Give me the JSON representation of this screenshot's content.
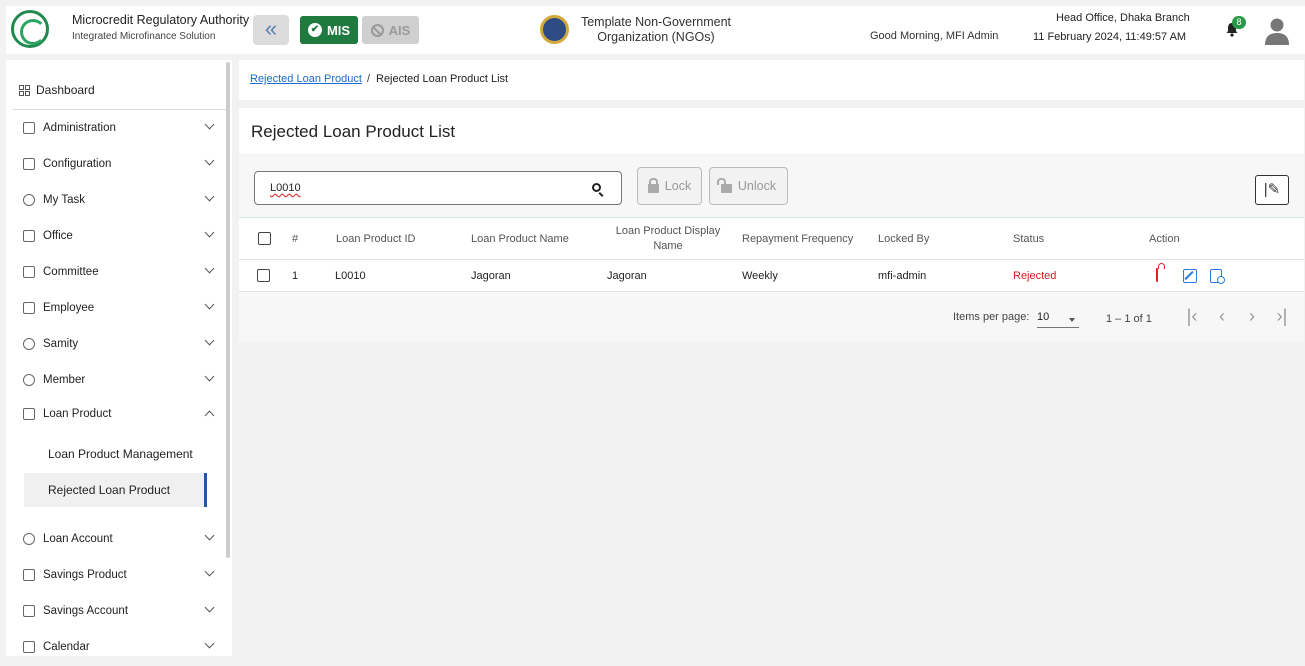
{
  "header": {
    "brand_title": "Microcredit Regulatory Authority",
    "brand_subtitle": "Integrated Microfinance Solution",
    "mis_label": "MIS",
    "ais_label": "AIS",
    "org_line1": "Template Non-Government",
    "org_line2": "Organization (NGOs)",
    "greeting": "Good Morning, MFI Admin",
    "branch": "Head Office, Dhaka Branch",
    "datetime": "11 February 2024, 11:49:57 AM",
    "notification_count": "8"
  },
  "sidebar": {
    "dashboard": "Dashboard",
    "items": [
      {
        "label": "Administration",
        "icon": "admin-icon"
      },
      {
        "label": "Configuration",
        "icon": "config-icon"
      },
      {
        "label": "My Task",
        "icon": "task-icon"
      },
      {
        "label": "Office",
        "icon": "office-icon"
      },
      {
        "label": "Committee",
        "icon": "committee-icon"
      },
      {
        "label": "Employee",
        "icon": "employee-icon"
      },
      {
        "label": "Samity",
        "icon": "samity-icon"
      },
      {
        "label": "Member",
        "icon": "member-icon"
      },
      {
        "label": "Loan Product",
        "icon": "loan-product-icon"
      },
      {
        "label": "Loan Account",
        "icon": "loan-account-icon"
      },
      {
        "label": "Savings Product",
        "icon": "savings-product-icon"
      },
      {
        "label": "Savings Account",
        "icon": "savings-account-icon"
      },
      {
        "label": "Calendar",
        "icon": "calendar-icon"
      }
    ],
    "sub_items": [
      {
        "label": "Loan Product Management"
      },
      {
        "label": "Rejected Loan Product"
      }
    ]
  },
  "breadcrumb": {
    "link": "Rejected Loan Product",
    "separator": "/",
    "current": "Rejected Loan Product List"
  },
  "page": {
    "title": "Rejected Loan Product List",
    "search_value": "L0010",
    "lock_label": "Lock",
    "unlock_label": "Unlock"
  },
  "table": {
    "headers": [
      "#",
      "Loan Product ID",
      "Loan Product Name",
      "Loan Product Display Name",
      "Repayment Frequency",
      "Locked By",
      "Status",
      "Action"
    ],
    "rows": [
      {
        "no": "1",
        "id": "L0010",
        "name": "Jagoran",
        "display_name": "Jagoran",
        "frequency": "Weekly",
        "locked_by": "mfi-admin",
        "status": "Rejected"
      }
    ]
  },
  "paginator": {
    "items_per_page_label": "Items per page:",
    "items_per_page": "10",
    "range": "1 – 1 of 1"
  },
  "colors": {
    "brand_green": "#1f7a3f",
    "rejected_red": "#d81b1b",
    "link_blue": "#1a6ad1",
    "active_indicator": "#1f5aa6"
  }
}
